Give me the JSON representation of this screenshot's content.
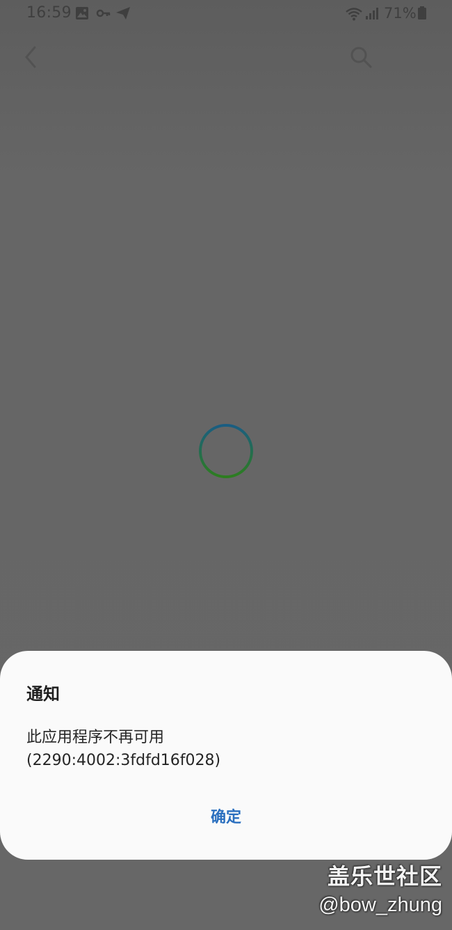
{
  "status_bar": {
    "time": "16:59",
    "battery_percent": "71%",
    "icons": [
      "image-icon",
      "key-icon",
      "send-icon",
      "wifi-icon",
      "signal-icon",
      "battery-icon"
    ]
  },
  "app_bar": {
    "back_icon": "chevron-left-icon",
    "search_icon": "search-icon"
  },
  "loading": {
    "spinner_icon": "loading-spinner-icon",
    "colors": [
      "#1a5d82",
      "#2d7d1f"
    ]
  },
  "dialog": {
    "title": "通知",
    "message_line1": "此应用程序不再可用",
    "message_line2": "(2290:4002:3fdfd16f028)",
    "ok_label": "确定",
    "accent_color": "#2a6fbf"
  },
  "watermark": {
    "title": "盖乐世社区",
    "handle": "@bow_zhung"
  }
}
